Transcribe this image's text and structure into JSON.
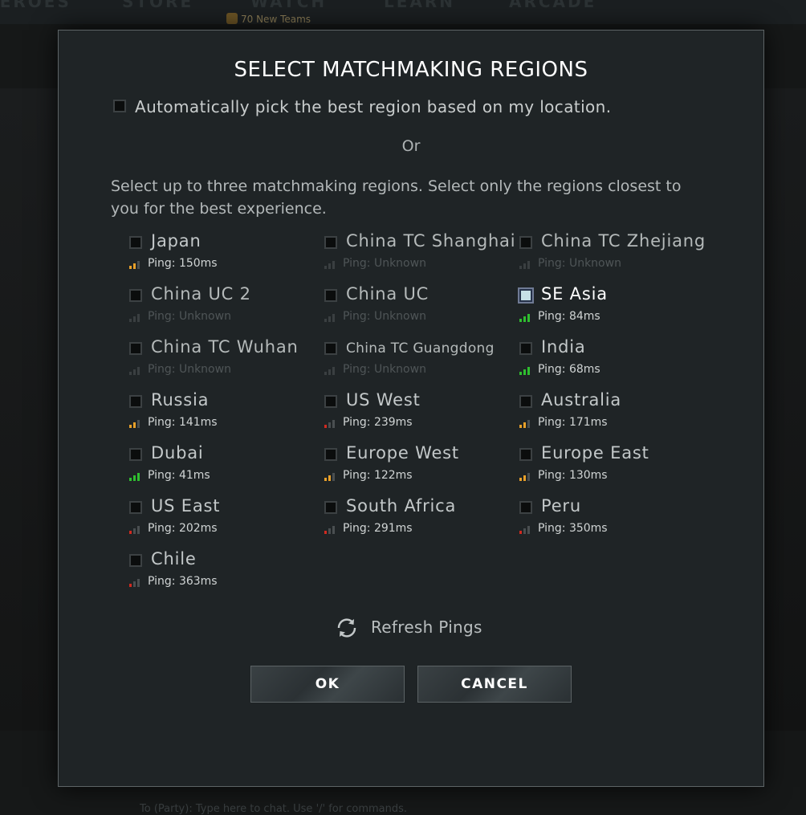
{
  "background": {
    "nav_items": [
      "HEROES",
      "STORE",
      "WATCH",
      "LEARN",
      "ARCADE"
    ],
    "news_text": "70 New Teams",
    "chat_text": "To (Party): Type here to chat. Use '/' for commands."
  },
  "dialog": {
    "title": "SELECT MATCHMAKING REGIONS",
    "auto_pick_label": "Automatically pick the best region based on my location.",
    "auto_pick_checked": false,
    "or_text": "Or",
    "instructions": "Select up to three matchmaking regions. Select only the regions closest to you for the best experience.",
    "regions": [
      {
        "name": "Japan",
        "ping": "Ping: 150ms",
        "signal": "medium",
        "checked": false
      },
      {
        "name": "China TC Shanghai",
        "ping": "Ping: Unknown",
        "signal": "unknown",
        "checked": false
      },
      {
        "name": "China TC Zhejiang",
        "ping": "Ping: Unknown",
        "signal": "unknown",
        "checked": false
      },
      {
        "name": "China UC 2",
        "ping": "Ping: Unknown",
        "signal": "unknown",
        "checked": false
      },
      {
        "name": "China UC",
        "ping": "Ping: Unknown",
        "signal": "unknown",
        "checked": false
      },
      {
        "name": "SE Asia",
        "ping": "Ping: 84ms",
        "signal": "good",
        "checked": true
      },
      {
        "name": "China TC Wuhan",
        "ping": "Ping: Unknown",
        "signal": "unknown",
        "checked": false
      },
      {
        "name": "China TC Guangdong",
        "ping": "Ping: Unknown",
        "signal": "unknown",
        "checked": false
      },
      {
        "name": "India",
        "ping": "Ping: 68ms",
        "signal": "good",
        "checked": false
      },
      {
        "name": "Russia",
        "ping": "Ping: 141ms",
        "signal": "medium",
        "checked": false
      },
      {
        "name": "US West",
        "ping": "Ping: 239ms",
        "signal": "poor",
        "checked": false
      },
      {
        "name": "Australia",
        "ping": "Ping: 171ms",
        "signal": "medium",
        "checked": false
      },
      {
        "name": "Dubai",
        "ping": "Ping: 41ms",
        "signal": "good",
        "checked": false
      },
      {
        "name": "Europe West",
        "ping": "Ping: 122ms",
        "signal": "medium",
        "checked": false
      },
      {
        "name": "Europe East",
        "ping": "Ping: 130ms",
        "signal": "medium",
        "checked": false
      },
      {
        "name": "US East",
        "ping": "Ping: 202ms",
        "signal": "poor",
        "checked": false
      },
      {
        "name": "South Africa",
        "ping": "Ping: 291ms",
        "signal": "poor",
        "checked": false
      },
      {
        "name": "Peru",
        "ping": "Ping: 350ms",
        "signal": "poor",
        "checked": false
      },
      {
        "name": "Chile",
        "ping": "Ping: 363ms",
        "signal": "poor",
        "checked": false
      }
    ],
    "refresh_label": "Refresh Pings",
    "ok_label": "OK",
    "cancel_label": "CANCEL"
  },
  "signal_colors": {
    "good": "#2fbf2f",
    "medium": "#e8a02a",
    "poor": "#d02a20",
    "inactive": "#4a4f51",
    "unknown": "#3a3f41"
  }
}
